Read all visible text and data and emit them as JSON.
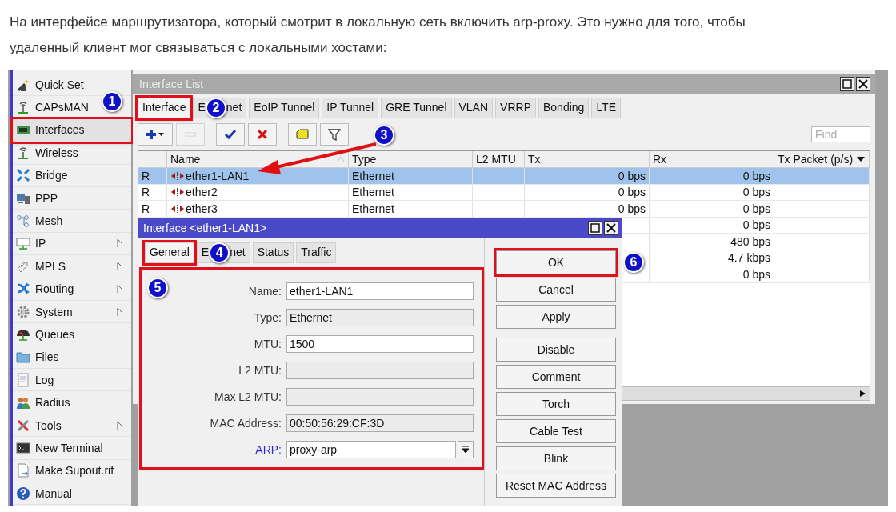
{
  "intro": "На интерфейсе маршрутизатора, который смотрит в локальную сеть включить arp-proxy. Это нужно для того, чтобы удаленный клиент мог связываться с локальными хостами:",
  "sidebar": {
    "items": [
      {
        "label": "Quick Set",
        "has_submenu": false,
        "highlighted": false
      },
      {
        "label": "CAPsMAN",
        "has_submenu": false,
        "highlighted": false
      },
      {
        "label": "Interfaces",
        "has_submenu": false,
        "highlighted": true
      },
      {
        "label": "Wireless",
        "has_submenu": false,
        "highlighted": false
      },
      {
        "label": "Bridge",
        "has_submenu": false,
        "highlighted": false
      },
      {
        "label": "PPP",
        "has_submenu": false,
        "highlighted": false
      },
      {
        "label": "Mesh",
        "has_submenu": false,
        "highlighted": false
      },
      {
        "label": "IP",
        "has_submenu": true,
        "highlighted": false
      },
      {
        "label": "MPLS",
        "has_submenu": true,
        "highlighted": false
      },
      {
        "label": "Routing",
        "has_submenu": true,
        "highlighted": false
      },
      {
        "label": "System",
        "has_submenu": true,
        "highlighted": false
      },
      {
        "label": "Queues",
        "has_submenu": false,
        "highlighted": false
      },
      {
        "label": "Files",
        "has_submenu": false,
        "highlighted": false
      },
      {
        "label": "Log",
        "has_submenu": false,
        "highlighted": false
      },
      {
        "label": "Radius",
        "has_submenu": false,
        "highlighted": false
      },
      {
        "label": "Tools",
        "has_submenu": true,
        "highlighted": false
      },
      {
        "label": "New Terminal",
        "has_submenu": false,
        "highlighted": false
      },
      {
        "label": "Make Supout.rif",
        "has_submenu": false,
        "highlighted": false
      },
      {
        "label": "Manual",
        "has_submenu": false,
        "highlighted": false
      }
    ]
  },
  "window": {
    "title": "Interface List",
    "tabs": [
      {
        "label": "Interface",
        "selected": true,
        "highlighted": true
      },
      {
        "label_parts": [
          "E",
          "net"
        ],
        "selected": false,
        "highlighted": false
      },
      {
        "label": "EoIP Tunnel",
        "selected": false,
        "highlighted": false
      },
      {
        "label": "IP Tunnel",
        "selected": false,
        "highlighted": false
      },
      {
        "label": "GRE Tunnel",
        "selected": false,
        "highlighted": false
      },
      {
        "label": "VLAN",
        "selected": false,
        "highlighted": false
      },
      {
        "label": "VRRP",
        "selected": false,
        "highlighted": false
      },
      {
        "label": "Bonding",
        "selected": false,
        "highlighted": false
      },
      {
        "label": "LTE",
        "selected": false,
        "highlighted": false
      }
    ],
    "toolbar": [
      {
        "disabled": false
      },
      {
        "disabled": true
      },
      {
        "disabled": false
      },
      {
        "disabled": false
      },
      {
        "disabled": false
      },
      {
        "disabled": false
      }
    ],
    "search": {
      "placeholder": "Find"
    },
    "table": {
      "columns": [
        "",
        "Name",
        "Type",
        "L2 MTU",
        "Tx",
        "Rx",
        "Tx Packet (p/s)"
      ],
      "rows": [
        {
          "flag": "R",
          "name": "ether1-LAN1",
          "type": "Ethernet",
          "tx": "0 bps",
          "rx": "0 bps",
          "selected": true
        },
        {
          "flag": "R",
          "name": "ether2",
          "type": "Ethernet",
          "tx": "0 bps",
          "rx": "0 bps",
          "selected": false
        },
        {
          "flag": "R",
          "name": "ether3",
          "type": "Ethernet",
          "tx": "0 bps",
          "rx": "0 bps",
          "selected": false
        },
        {
          "rx": "0 bps",
          "selected": false
        },
        {
          "rx": "480 bps",
          "selected": false
        },
        {
          "rx": "4.7 kbps",
          "selected": false
        },
        {
          "rx": "0 bps",
          "selected": false
        }
      ]
    }
  },
  "dialog": {
    "title": "Interface <ether1-LAN1>",
    "tabs": [
      {
        "label": "General",
        "selected": true,
        "highlighted": true
      },
      {
        "label_parts": [
          "E",
          "net"
        ],
        "selected": false,
        "highlighted": false
      },
      {
        "label": "Status",
        "selected": false,
        "highlighted": false
      },
      {
        "label": "Traffic",
        "selected": false,
        "highlighted": false
      }
    ],
    "form_highlighted": true,
    "fields": [
      {
        "label": "Name:",
        "value": "ether1-LAN1",
        "readonly": false,
        "kind": "text"
      },
      {
        "label": "Type:",
        "value": "Ethernet",
        "readonly": true,
        "kind": "text"
      },
      {
        "label": "MTU:",
        "value": "1500",
        "readonly": false,
        "kind": "text"
      },
      {
        "label": "L2 MTU:",
        "readonly": true,
        "kind": "text"
      },
      {
        "label": "Max L2 MTU:",
        "readonly": true,
        "kind": "text"
      },
      {
        "label": "MAC Address:",
        "value": "00:50:56:29:CF:3D",
        "readonly": true,
        "kind": "text"
      },
      {
        "label": "ARP:",
        "value": "proxy-arp",
        "readonly": false,
        "kind": "dropdown"
      }
    ],
    "buttons": [
      {
        "label": "OK",
        "highlighted": true
      },
      {
        "label": "Cancel",
        "highlighted": false
      },
      {
        "label": "Apply",
        "highlighted": false
      },
      {
        "label": "Disable",
        "highlighted": false
      },
      {
        "label": "Comment",
        "highlighted": false
      },
      {
        "label": "Torch",
        "highlighted": false
      },
      {
        "label": "Cable Test",
        "highlighted": false
      },
      {
        "label": "Blink",
        "highlighted": false
      },
      {
        "label": "Reset MAC Address",
        "highlighted": false
      }
    ]
  },
  "badges": [
    "1",
    "2",
    "3",
    "4",
    "5",
    "6"
  ]
}
